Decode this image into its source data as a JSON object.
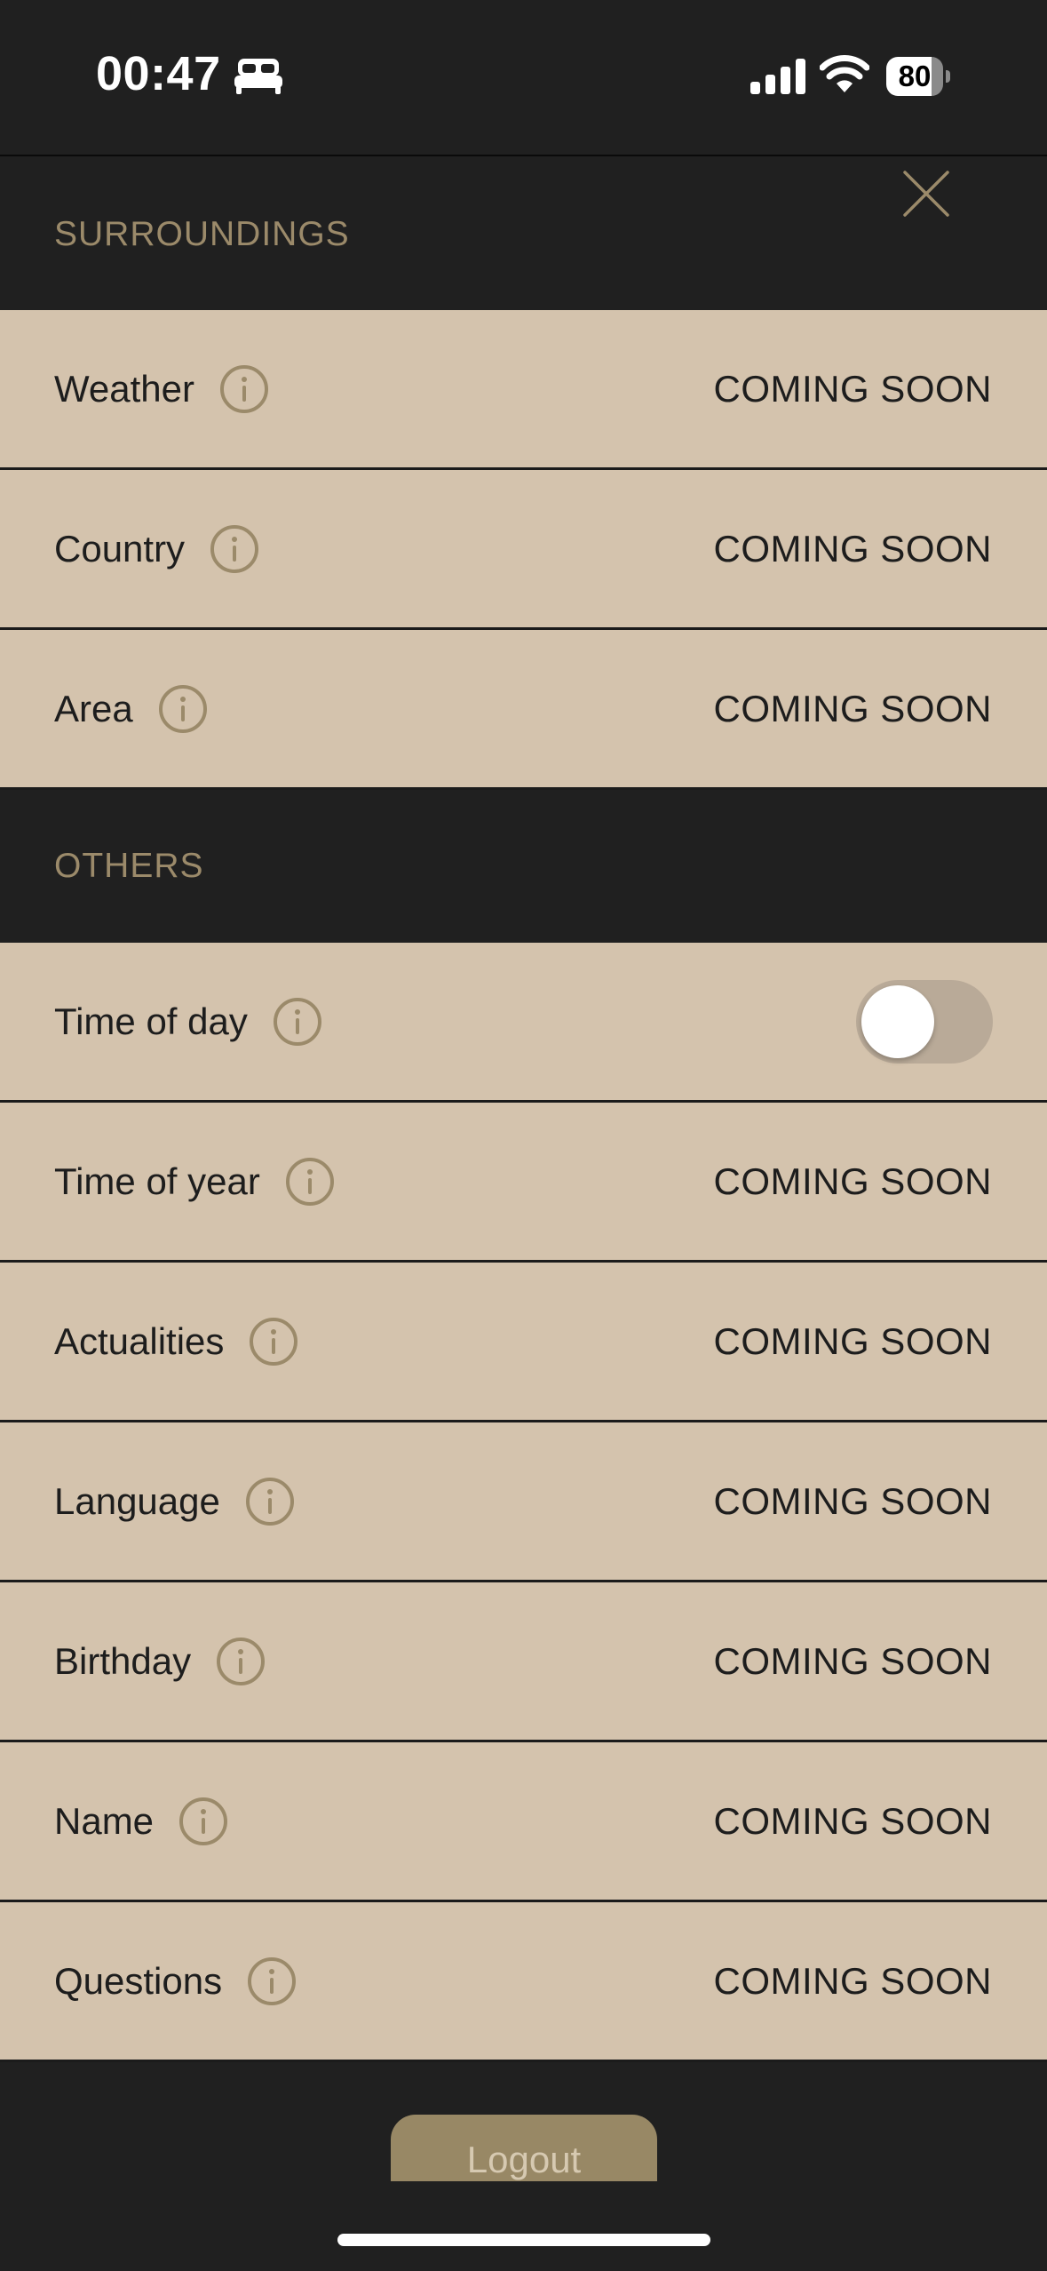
{
  "status_bar": {
    "time": "00:47",
    "battery_level": "80",
    "battery_fraction": 0.8,
    "icons": [
      "bed-icon",
      "cellular-signal-icon",
      "wifi-icon",
      "battery-icon"
    ]
  },
  "close_icon": "close-icon",
  "sections": [
    {
      "title": "SURROUNDINGS",
      "rows": [
        {
          "label": "Weather",
          "value": "COMING SOON"
        },
        {
          "label": "Country",
          "value": "COMING SOON"
        },
        {
          "label": "Area",
          "value": "COMING SOON"
        }
      ]
    },
    {
      "title": "OTHERS",
      "rows": [
        {
          "label": "Time of day",
          "toggle": false
        },
        {
          "label": "Time of year",
          "value": "COMING SOON"
        },
        {
          "label": "Actualities",
          "value": "COMING SOON"
        },
        {
          "label": "Language",
          "value": "COMING SOON"
        },
        {
          "label": "Birthday",
          "value": "COMING SOON"
        },
        {
          "label": "Name",
          "value": "COMING SOON"
        },
        {
          "label": "Questions",
          "value": "COMING SOON"
        }
      ]
    }
  ],
  "footer": {
    "logout_label": "Logout"
  },
  "colors": {
    "background": "#202020",
    "row_background": "#d4c3ad",
    "accent": "#9b8a6a",
    "logout_button": "#988865",
    "toggle_off_track": "#b9aa98"
  }
}
